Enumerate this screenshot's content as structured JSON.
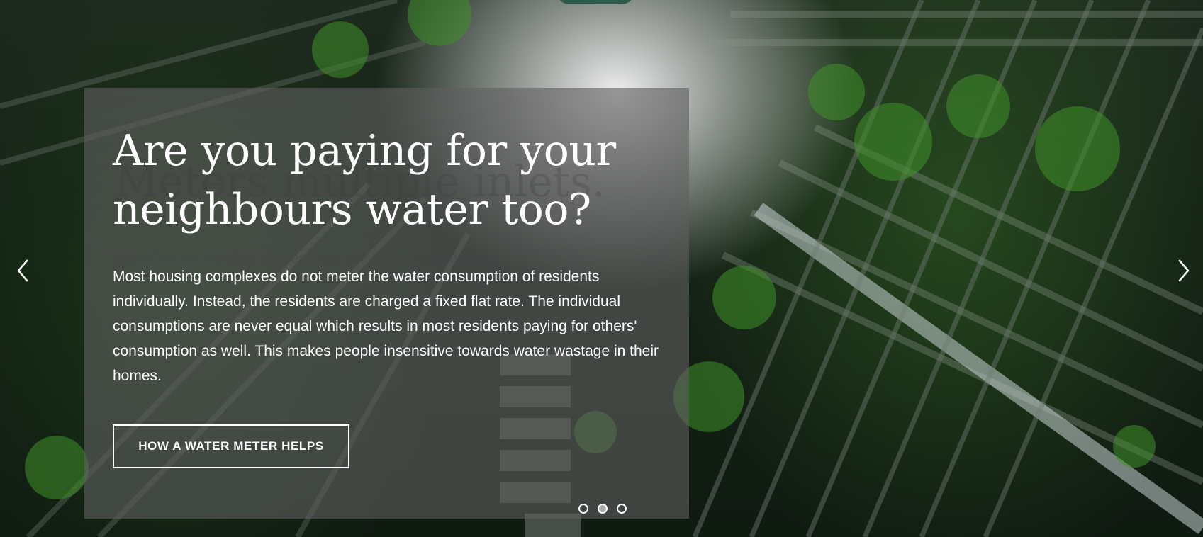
{
  "slide": {
    "headline": "Are you paying for your neighbours water too?",
    "ghost_headline": "Meters multiple inlets.",
    "body": "Most housing complexes do not meter the water consumption of residents individually. Instead, the residents are charged a fixed flat rate. The individual consumptions are never equal which results in most residents paying for others' consumption as well. This makes people insensitive towards water wastage in their homes.",
    "ghost_body": "WaterOps are installed at every inlet point. Each consumption",
    "cta_label": "HOW A WATER METER HELPS"
  },
  "carousel": {
    "total_slides": 3,
    "active_index": 1
  },
  "icons": {
    "prev": "chevron-left-icon",
    "next": "chevron-right-icon"
  },
  "colors": {
    "overlay": "#5f5f5f",
    "text": "#ffffff"
  }
}
